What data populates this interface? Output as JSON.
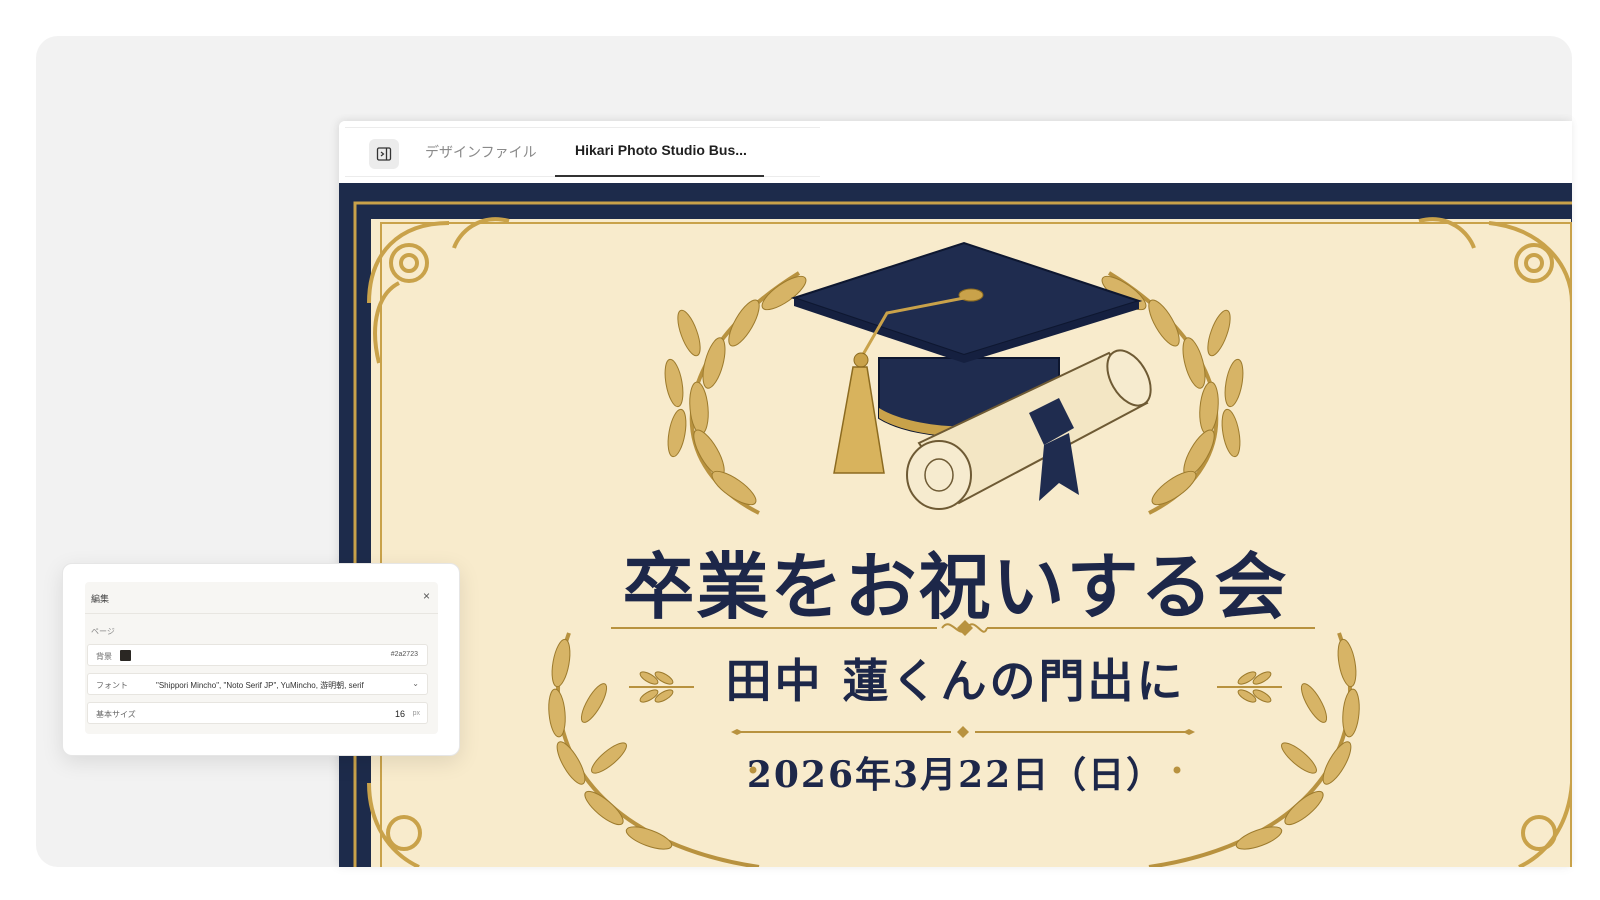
{
  "tabs": {
    "design_file": "デザインファイル",
    "active": "Hikari Photo Studio Bus..."
  },
  "card": {
    "title": "卒業をお祝いする会",
    "subtitle": "田中 蓮くんの門出に",
    "date": "2026年3月22日（日）"
  },
  "panel": {
    "title": "編集",
    "section": "ページ",
    "background_label": "背景",
    "background_value": "#2a2723",
    "font_label": "フォント",
    "font_value": "\"Shippori Mincho\", \"Noto Serif JP\", YuMincho, 游明朝, serif",
    "size_label": "基本サイズ",
    "size_value": "16",
    "size_unit": "px"
  },
  "colors": {
    "navy": "#1d2b4b",
    "cream": "#f8ebcc",
    "gold": "#c9a24a"
  },
  "icons": {
    "sidebar_toggle": "sidebar-toggle-icon",
    "close": "close-icon",
    "dropdown": "chevron-down-icon"
  }
}
